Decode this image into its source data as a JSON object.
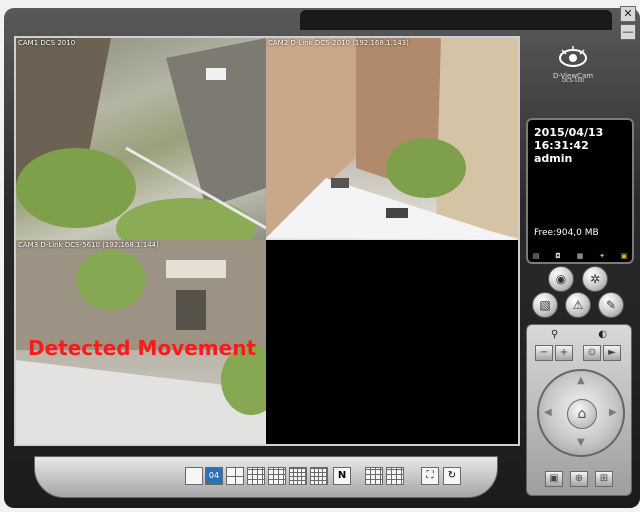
{
  "window": {
    "close_label": "✕",
    "minimize_label": "—"
  },
  "cameras": [
    {
      "label": "CAM1 DCS 2010"
    },
    {
      "label": "CAM2 D-Link DCS-2010 (192.168.1.143)"
    },
    {
      "label": "CAM3 D-Link DCS-5610 (192.168.1.144)"
    }
  ],
  "alert": {
    "text": "Detected Movement",
    "color": "#ff1a1a"
  },
  "logo": {
    "brand": "D-ViewCam",
    "sub": "DCS-100"
  },
  "info": {
    "date": "2015/04/13",
    "time": "16:31:42",
    "user": "admin",
    "free": "Free:904,0 MB"
  },
  "layout_bar": {
    "active_label": "04",
    "n_label": "N"
  },
  "icons": {
    "record": "record-icon",
    "camera": "camera-reel-icon",
    "settings": "settings-icon",
    "alarm": "alarm-icon",
    "tools": "tools-icon",
    "search": "search-icon",
    "zoom_minus": "zoom-minus-icon",
    "zoom_plus": "zoom-plus-icon"
  }
}
